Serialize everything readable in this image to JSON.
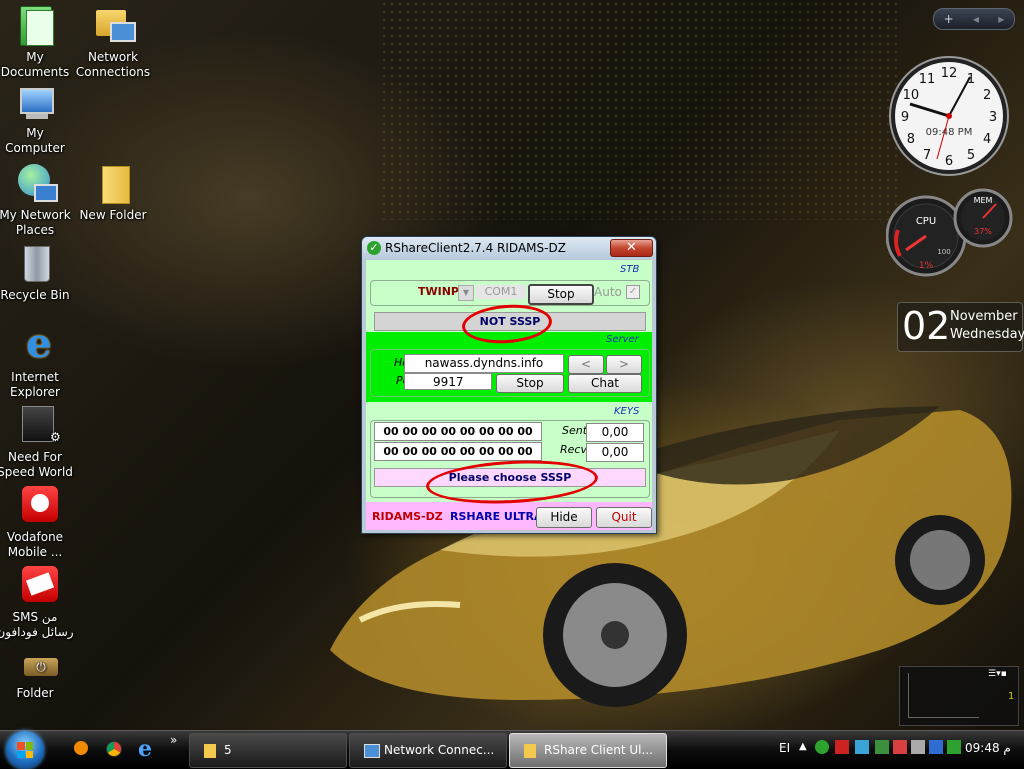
{
  "desktop": {
    "icons": [
      {
        "label": "My Documents"
      },
      {
        "label": "Network Connections"
      },
      {
        "label": "My Computer"
      },
      {
        "label": "My Network Places"
      },
      {
        "label": "New Folder"
      },
      {
        "label": "Recycle Bin"
      },
      {
        "label": "Internet Explorer"
      },
      {
        "label": "Need For Speed World"
      },
      {
        "label": "Vodafone Mobile ..."
      },
      {
        "label": "SMS من رسائل فودافون"
      },
      {
        "label": "Folder"
      }
    ]
  },
  "gadgets": {
    "clock_digital": "09:48 PM",
    "clock_numbers": [
      "12",
      "1",
      "2",
      "3",
      "4",
      "5",
      "6",
      "7",
      "8",
      "9",
      "10",
      "11"
    ],
    "cpu_label": "CPU",
    "cpu_value": "1%",
    "mem_label": "MEM",
    "mem_value": "37%",
    "gauge_max": "100",
    "calendar_day": "02",
    "calendar_month": "November",
    "calendar_weekday": "Wednesday",
    "mini_value": "1"
  },
  "window": {
    "title": "RShareClient2.7.4 RIDAMS-DZ",
    "close_label": "✕",
    "stb": {
      "section_label": "STB",
      "receiver": "TWINP",
      "port_select": "COM1",
      "stop_label": "Stop",
      "auto_label": "Auto",
      "status": "NOT SSSP"
    },
    "server": {
      "section_label": "Server",
      "host_label": "Host",
      "host_value": "nawass.dyndns.info",
      "prev_label": "<",
      "next_label": ">",
      "port_label": "Port",
      "port_value": "9917",
      "stop_label": "Stop",
      "chat_label": "Chat"
    },
    "keys": {
      "section_label": "KEYS",
      "key1": "00 00 00 00 00 00 00 00",
      "key2": "00 00 00 00 00 00 00 00",
      "sent_label": "Sent",
      "sent_value": "0,00",
      "recv_label": "Recv",
      "recv_value": "0,00",
      "message": "Please choose SSSP"
    },
    "footer": {
      "brand_left": "RIDAMS-DZ",
      "brand_right": "RSHARE ULTRA",
      "hide_label": "Hide",
      "quit_label": "Quit"
    }
  },
  "taskbar": {
    "overflow": "»",
    "tasks": [
      {
        "label": "5"
      },
      {
        "label": "Network Connec..."
      },
      {
        "label": "RShare Client Ul..."
      }
    ],
    "tray_language": "EI",
    "time": "09:48 م"
  },
  "topbar": {
    "plus": "+",
    "left": "◂",
    "right": "▸"
  },
  "colors": {
    "client_bg": "#c8ffc8",
    "server_bg": "#00ee00",
    "accent_red": "#e30000",
    "label_blue": "#1531b8"
  }
}
